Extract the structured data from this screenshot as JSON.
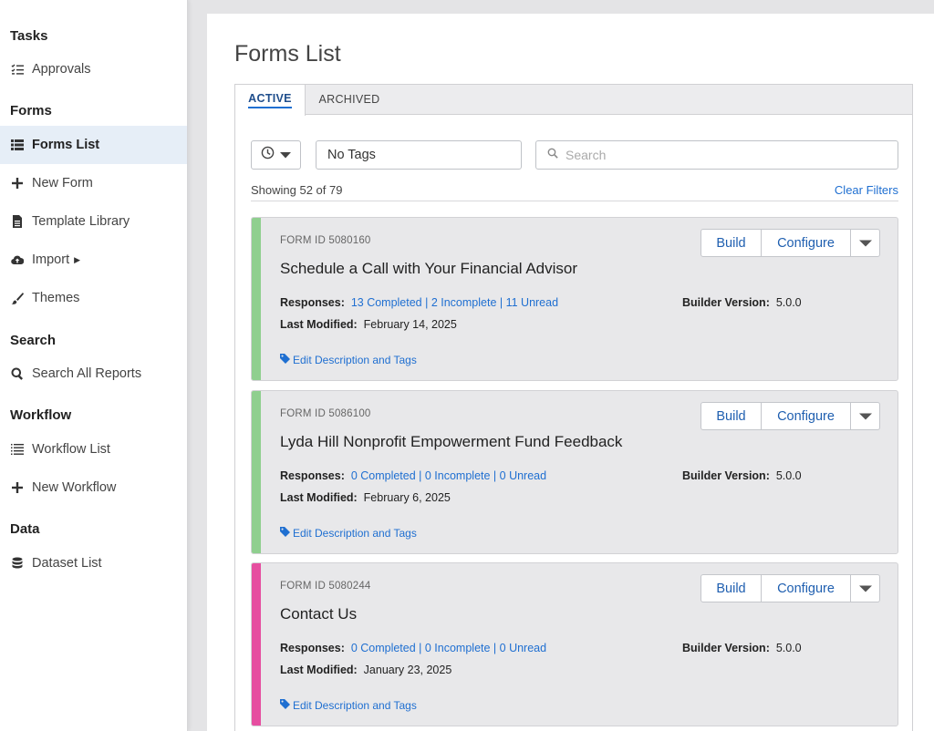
{
  "sidebar": {
    "sections": [
      {
        "title": "Tasks",
        "items": [
          {
            "label": "Approvals",
            "icon": "approvals-list-icon",
            "active": false
          }
        ]
      },
      {
        "title": "Forms",
        "items": [
          {
            "label": "Forms List",
            "icon": "forms-list-icon",
            "active": true
          },
          {
            "label": "New Form",
            "icon": "plus-icon",
            "active": false
          },
          {
            "label": "Template Library",
            "icon": "document-icon",
            "active": false
          },
          {
            "label": "Import",
            "icon": "cloud-upload-icon",
            "active": false
          },
          {
            "label": "Themes",
            "icon": "paintbrush-icon",
            "active": false
          }
        ]
      },
      {
        "title": "Search",
        "items": [
          {
            "label": "Search All Reports",
            "icon": "search-icon",
            "active": false
          }
        ]
      },
      {
        "title": "Workflow",
        "items": [
          {
            "label": "Workflow List",
            "icon": "workflow-list-icon",
            "active": false
          },
          {
            "label": "New Workflow",
            "icon": "plus-icon",
            "active": false
          }
        ]
      },
      {
        "title": "Data",
        "items": [
          {
            "label": "Dataset List",
            "icon": "database-icon",
            "active": false
          }
        ]
      }
    ]
  },
  "main": {
    "title": "Forms List",
    "tabs": [
      {
        "label": "ACTIVE",
        "active": true
      },
      {
        "label": "ARCHIVED",
        "active": false
      }
    ],
    "filters": {
      "tag_value": "No Tags",
      "search_placeholder": "Search"
    },
    "showing": "Showing 52 of 79",
    "clear_filters": "Clear Filters",
    "buttons": {
      "build": "Build",
      "configure": "Configure"
    },
    "labels": {
      "responses": "Responses:",
      "last_modified": "Last Modified:",
      "builder_version": "Builder Version:",
      "edit": "Edit Description and Tags"
    },
    "forms": [
      {
        "form_id": "FORM ID 5080160",
        "title": "Schedule a Call with Your Financial Advisor",
        "responses": "13 Completed | 2 Incomplete | 11 Unread",
        "last_modified": "February 14, 2025",
        "builder_version": "5.0.0",
        "stripe_color": "#8fcf8f"
      },
      {
        "form_id": "FORM ID 5086100",
        "title": "Lyda Hill Nonprofit Empowerment Fund Feedback",
        "responses": "0 Completed | 0 Incomplete | 0 Unread",
        "last_modified": "February 6, 2025",
        "builder_version": "5.0.0",
        "stripe_color": "#8fcf8f"
      },
      {
        "form_id": "FORM ID 5080244",
        "title": "Contact Us",
        "responses": "0 Completed | 0 Incomplete | 0 Unread",
        "last_modified": "January 23, 2025",
        "builder_version": "5.0.0",
        "stripe_color": "#e64ea0"
      }
    ]
  },
  "colors": {
    "accent": "#1f6fd1",
    "active_nav_bg": "#e6eef7"
  }
}
